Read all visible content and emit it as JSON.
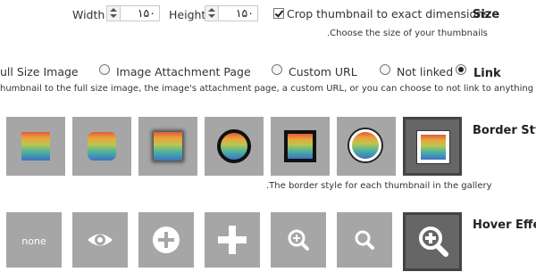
{
  "size": {
    "width_label": "Width",
    "width_value": "۱۵۰",
    "height_label": "Height",
    "height_value": "۱۵۰",
    "crop_label": "Crop thumbnail to exact dimensions",
    "crop_checked": true,
    "heading": "Size",
    "description": ".Choose the size of your thumbnails"
  },
  "link": {
    "heading": "Link",
    "options": [
      "ull Size Image",
      "Image Attachment Page",
      "Custom URL",
      "Not linked"
    ],
    "selected_index": 4,
    "description": "humbnail to the full size image, the image's attachment page, a custom URL, or you can choose to not link to anything"
  },
  "border": {
    "heading": "Border Sty",
    "description": ".The border style for each thumbnail in the gallery",
    "selected_index": 6,
    "styles": [
      "square-plain",
      "rounded",
      "square-shadow",
      "circle-thick-border",
      "square-thick-border",
      "circle-white-border",
      "square-white-border"
    ]
  },
  "hover": {
    "heading": "Hover Effe",
    "selected_index": 6,
    "items": [
      {
        "label": "none",
        "icon": ""
      },
      {
        "label": "",
        "icon": "eye-icon"
      },
      {
        "label": "",
        "icon": "plus-circle-icon"
      },
      {
        "label": "",
        "icon": "plus-icon"
      },
      {
        "label": "",
        "icon": "zoom-in-small-icon"
      },
      {
        "label": "",
        "icon": "search-icon"
      },
      {
        "label": "",
        "icon": "zoom-in-icon"
      }
    ]
  }
}
